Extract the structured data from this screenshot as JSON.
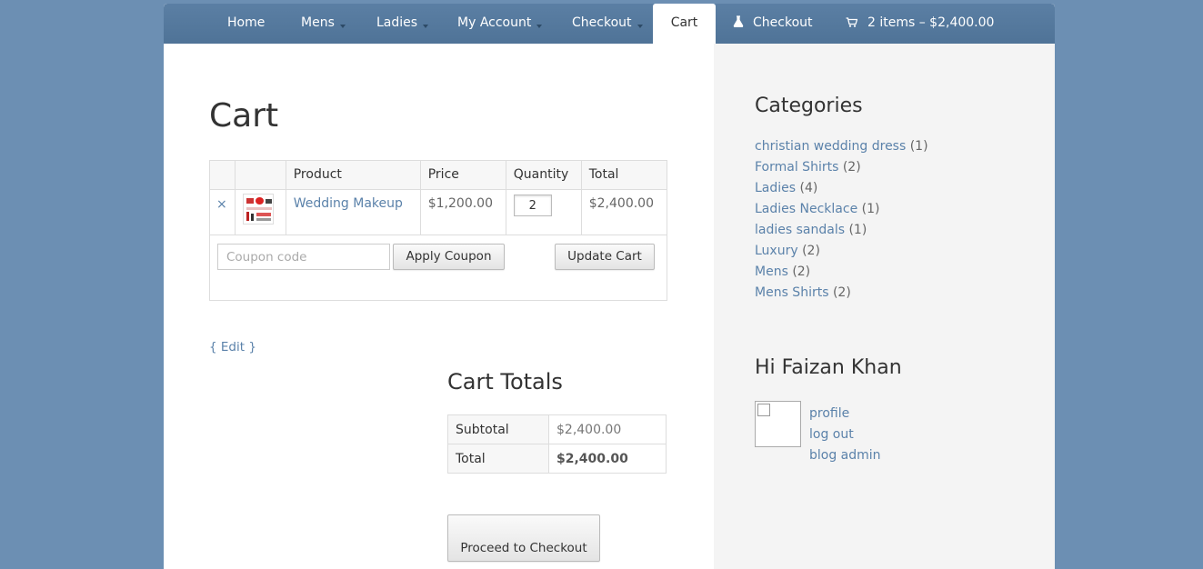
{
  "nav": {
    "items": [
      {
        "label": "Home",
        "dropdown": false
      },
      {
        "label": "Mens",
        "dropdown": true
      },
      {
        "label": "Ladies",
        "dropdown": true
      },
      {
        "label": "My Account",
        "dropdown": true
      },
      {
        "label": "Checkout",
        "dropdown": true
      },
      {
        "label": "Cart",
        "dropdown": false,
        "active": true
      },
      {
        "label": "Checkout",
        "dropdown": false,
        "icon": "flask-icon"
      }
    ],
    "cart_summary": "2 items – $2,400.00",
    "cart_icon": "cart-icon"
  },
  "page": {
    "title": "Cart",
    "edit_link": "{ Edit }"
  },
  "cart_table": {
    "headers": [
      "",
      "",
      "Product",
      "Price",
      "Quantity",
      "Total"
    ],
    "rows": [
      {
        "remove": "×",
        "product": "Wedding Makeup",
        "price": "$1,200.00",
        "quantity": "2",
        "total": "$2,400.00"
      }
    ],
    "coupon_placeholder": "Coupon code",
    "apply_coupon_label": "Apply Coupon",
    "update_cart_label": "Update Cart"
  },
  "cart_totals": {
    "title": "Cart Totals",
    "rows": [
      {
        "label": "Subtotal",
        "value": "$2,400.00"
      },
      {
        "label": "Total",
        "value": "$2,400.00"
      }
    ],
    "checkout_label": "Proceed to Checkout"
  },
  "sidebar": {
    "categories_title": "Categories",
    "categories": [
      {
        "name": "christian wedding dress",
        "count": "(1)"
      },
      {
        "name": "Formal Shirts",
        "count": "(2)"
      },
      {
        "name": "Ladies",
        "count": "(4)"
      },
      {
        "name": "Ladies Necklace",
        "count": "(1)"
      },
      {
        "name": "ladies sandals",
        "count": "(1)"
      },
      {
        "name": "Luxury",
        "count": "(2)"
      },
      {
        "name": "Mens",
        "count": "(2)"
      },
      {
        "name": "Mens Shirts",
        "count": "(2)"
      }
    ],
    "greeting": "Hi Faizan Khan",
    "user_links": [
      "profile",
      "log out",
      "blog admin"
    ]
  },
  "colors": {
    "background": "#6c8fb3",
    "nav": "#5479a0",
    "link": "#5b82aa",
    "sidebar": "#f4f4f4"
  }
}
